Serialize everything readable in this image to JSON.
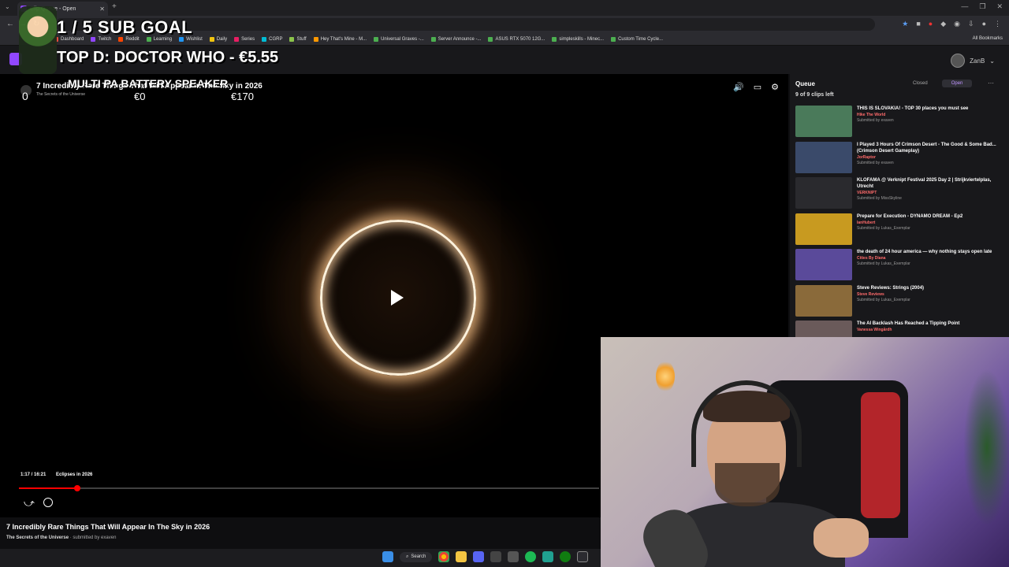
{
  "browser": {
    "tab_title": "Clip Queue - Open",
    "bookmarks": [
      "Dashboard",
      "Twitch",
      "Reddit",
      "Learning",
      "Wishlist",
      "Daily",
      "Series",
      "CGRP",
      "Stuff",
      "Hey That's Mine - M...",
      "Universal Graves -...",
      "Server Announce -...",
      "ASUS RTX 5070 12G...",
      "simpleskills - Minec...",
      "Custom Time Cycle..."
    ],
    "all_bookmarks": "All Bookmarks",
    "bookmark_colors": [
      "#e74c3c",
      "#9147ff",
      "#ff4500",
      "#4caf50",
      "#2196f3",
      "#f1c40f",
      "#e91e63",
      "#00bcd4",
      "#8bc34a",
      "#ff9800",
      "#4caf50",
      "#4caf50",
      "#4caf50",
      "#4caf50",
      "#4caf50"
    ]
  },
  "header": {
    "username": "ZanB"
  },
  "overlay": {
    "sub_goal": "1 / 5 SUB GOAL",
    "top_donation": "TOP D: DOCTOR WHO - €5.55",
    "goal_name": "MULTI PA BATTERY SPEAKER",
    "count": "0",
    "goal_current": "€0",
    "goal_target": "€170"
  },
  "video": {
    "title": "7 Incredibly Rare Things That Will Appear in The Sky in 2026",
    "channel": "The Secrets of the Universe",
    "time": "1:17 / 16:21",
    "chapter": "Eclipses in 2026",
    "progress": 0.1,
    "below_title": "7 Incredibly Rare Things That Will Appear In The Sky in 2026",
    "below_channel": "The Secrets of the Universe",
    "below_submitted": "submitted by exaven"
  },
  "queue": {
    "title": "Queue",
    "tab_closed": "Closed",
    "tab_open": "Open",
    "clips_left": "9 of 9 clips left",
    "items": [
      {
        "title": "THIS IS SLOVAKIA! - TOP 30 places you must see",
        "channel": "Hike The World",
        "submitted": "Submitted by exaven",
        "color": "#4a7a5a"
      },
      {
        "title": "I Played 3 Hours Of Crimson Desert - The Good & Some Bad... (Crimson Desert Gameplay)",
        "channel": "JorRaptor",
        "submitted": "Submitted by exaven",
        "color": "#3a4a6a"
      },
      {
        "title": "KLOFAMA @ Verknipt Festival 2025 Day 2 | Strijkviertelplas, Utrecht",
        "channel": "VERKNIPT",
        "submitted": "Submitted by MissSkyline",
        "color": "#2a2a2e"
      },
      {
        "title": "Prepare for Execution - DYNAMO DREAM - Ep2",
        "channel": "IanHubert",
        "submitted": "Submitted by Lukas_Exemplar",
        "color": "#c89a20"
      },
      {
        "title": "the death of 24 hour america — why nothing stays open late",
        "channel": "Cities By Diana",
        "submitted": "Submitted by Lukas_Exemplar",
        "color": "#5a4a9a"
      },
      {
        "title": "Steve Reviews: Strings (2004)",
        "channel": "Steve Reviews",
        "submitted": "Submitted by Lukas_Exemplar",
        "color": "#8a6a3a"
      },
      {
        "title": "The AI Backlash Has Reached a Tipping Point",
        "channel": "Vanessa Wingårdh",
        "submitted": "",
        "color": "#6a5a5a"
      }
    ]
  },
  "taskbar": {
    "search": "Search"
  }
}
